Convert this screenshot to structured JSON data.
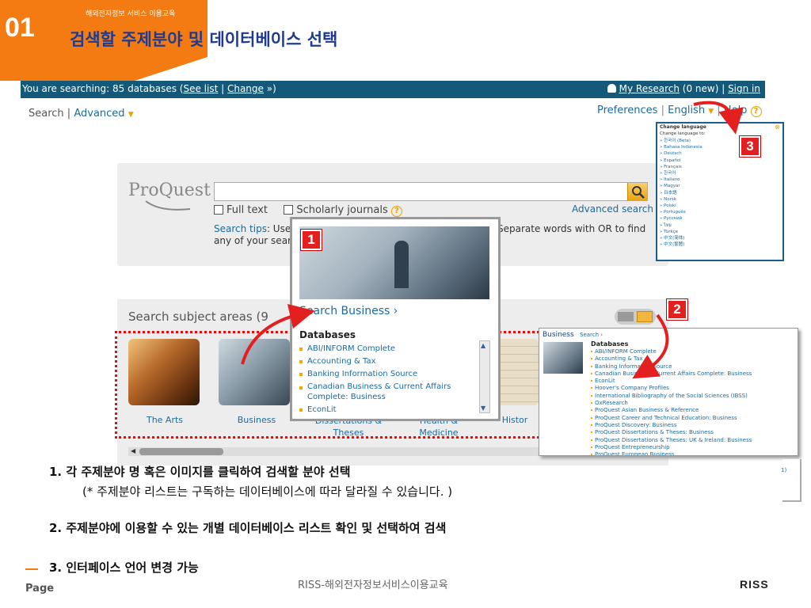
{
  "slide": {
    "number": "01",
    "subtitle": "해외전자정보 서비스 이용교육",
    "title": "검색할 주제분야 및 데이터베이스 선택",
    "page_label": "Page",
    "footer_center": "RISS-해외전자정보서비스이용교육",
    "logo_text": "RISS",
    "colors": {
      "accent": "#f47a12",
      "title": "#1f3b8f",
      "bar": "#14597a",
      "badge": "#e41f1f"
    }
  },
  "topbar": {
    "searching_prefix": "You are searching: 85 databases (",
    "see_list": "See list",
    "change": "Change",
    "searching_suffix": " »)",
    "my_research": "My Research",
    "my_research_count": " (0 new) | ",
    "sign_in": "Sign in"
  },
  "nav": {
    "search": "Search",
    "separator": " | ",
    "advanced": "Advanced",
    "advanced_icon": "caret-down-icon"
  },
  "prefs": {
    "preferences": "Preferences",
    "language": "English",
    "help": "Help"
  },
  "search": {
    "logo": "ProQuest",
    "input_value": "",
    "full_text": "Full text",
    "scholarly": "Scholarly journals",
    "advanced_search": "Advanced search",
    "tips_label": "Search tips",
    "tips_line1": ": Use",
    "tips_line2": "any of your searc",
    "tips_right": "Separate words with OR to find"
  },
  "subjects": {
    "title": "Search subject areas (9",
    "items": [
      {
        "label": "The Arts",
        "icon": "arts-image"
      },
      {
        "label": "Business",
        "icon": "business-image"
      },
      {
        "label": "Dissertations &\nTheses",
        "icon": "dissertations-image"
      },
      {
        "label": "Health &\nMedicine",
        "icon": "health-image"
      },
      {
        "label": "Histor",
        "icon": "history-image"
      }
    ]
  },
  "popup_business": {
    "search_link": "Search Business ›",
    "databases_heading": "Databases",
    "databases": [
      "ABI/INFORM Complete",
      "Accounting & Tax",
      "Banking Information Source",
      "Canadian Business & Current Affairs Complete: Business",
      "EconLit"
    ]
  },
  "popup_db": {
    "title": "Business",
    "search_link": "Search ›",
    "databases_heading": "Databases",
    "databases": [
      "ABI/INFORM Complete",
      "Accounting & Tax",
      "Banking Information Source",
      "Canadian Business & Current Affairs Complete: Business",
      "EconLit",
      "Hoover's Company Profiles",
      "International Bibliography of the Social Sciences (IBSS)",
      "OxResearch",
      "ProQuest Asian Business & Reference",
      "ProQuest Career and Technical Education: Business",
      "ProQuest Discovery: Business",
      "ProQuest Dissertations & Theses: Business",
      "ProQuest Dissertations & Theses: UK & Ireland: Business",
      "ProQuest Entrepreneurship",
      "ProQuest European Business"
    ],
    "more": "1)"
  },
  "popup_lang": {
    "title": "Change language",
    "subtitle": "Change language to:",
    "languages": [
      "한국어 (Beta)",
      "Bahasa Indonesia",
      "Deutsch",
      "Español",
      "Français",
      "한국어",
      "Italiano",
      "Magyar",
      "日本語",
      "Norsk",
      "Polski",
      "Português",
      "Русский",
      "ไทย",
      "Türkçe",
      "中文(简体)",
      "中文(繁體)"
    ]
  },
  "badges": [
    "1",
    "2",
    "3"
  ],
  "captions": {
    "c1": "1. 각 주제분야 명 혹은 이미지를 클릭하여 검색할 분야 선택",
    "c1b": "(* 주제분야 리스트는 구독하는 데이터베이스에 따라 달라질 수 있습니다. )",
    "c2": "2. 주제분야에 이용할 수 있는 개별 데이터베이스 리스트 확인 및 선택하여 검색",
    "c3": "3. 인터페이스 언어 변경 가능"
  }
}
